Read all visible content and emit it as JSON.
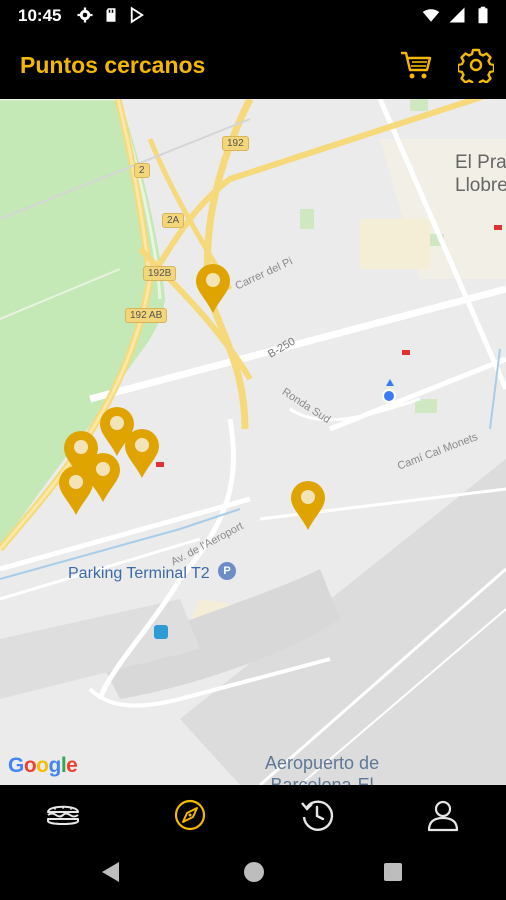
{
  "status_bar": {
    "time": "10:45",
    "left_icons": [
      "settings-icon",
      "sd-card-icon",
      "play-store-icon"
    ],
    "right_icons": [
      "wifi-icon",
      "signal-icon",
      "battery-icon"
    ]
  },
  "app_bar": {
    "title": "Puntos cercanos",
    "actions": [
      "cart-icon",
      "gear-icon"
    ],
    "accent_color": "#f5b800"
  },
  "map": {
    "place_labels": {
      "city_line1": "El Prat",
      "city_line2": "Llobreg",
      "parking": "Parking Terminal T2",
      "airport_line1": "Aeropuerto de",
      "airport_line2": "Barcelona-El"
    },
    "street_labels": {
      "carrer_pi": "Carrer del Pi",
      "ronda_sud": "Ronda Sud",
      "cami_monets": "Camí Cal Monets",
      "av_aeroport": "Av. de l'Aeroport",
      "b250": "B-250"
    },
    "road_shields": [
      "192",
      "2",
      "2A",
      "192B",
      "192 AB"
    ],
    "parking_symbol": "P",
    "pins": 7,
    "pin_color": "#e0a400",
    "attribution": [
      "G",
      "o",
      "o",
      "g",
      "l",
      "e"
    ]
  },
  "chat_fab": {
    "icon": "chat-help-icon"
  },
  "bottom_nav": {
    "items": [
      "sandwich-icon",
      "compass-icon",
      "history-icon",
      "profile-icon"
    ],
    "active_index": 1
  }
}
